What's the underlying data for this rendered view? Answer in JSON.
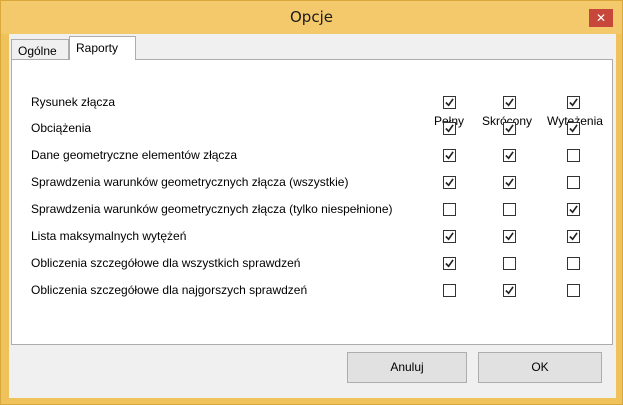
{
  "window": {
    "title": "Opcje",
    "close_glyph": "✕"
  },
  "tabs": [
    {
      "label": "Ogólne",
      "active": false
    },
    {
      "label": "Raporty",
      "active": true
    }
  ],
  "columns": [
    "Pełny",
    "Skrócony",
    "Wytężenia"
  ],
  "rows": [
    {
      "label": "Rysunek złącza",
      "checks": [
        true,
        true,
        true
      ]
    },
    {
      "label": "Obciążenia",
      "checks": [
        true,
        true,
        true
      ]
    },
    {
      "label": "Dane geometryczne elementów złącza",
      "checks": [
        true,
        true,
        false
      ]
    },
    {
      "label": "Sprawdzenia warunków geometrycznych złącza (wszystkie)",
      "checks": [
        true,
        true,
        false
      ]
    },
    {
      "label": "Sprawdzenia warunków geometrycznych złącza (tylko niespełnione)",
      "checks": [
        false,
        false,
        true
      ]
    },
    {
      "label": "Lista maksymalnych wytężeń",
      "checks": [
        true,
        true,
        true
      ]
    },
    {
      "label": "Obliczenia szczegółowe dla wszystkich sprawdzeń",
      "checks": [
        true,
        false,
        false
      ]
    },
    {
      "label": "Obliczenia szczegółowe dla najgorszych sprawdzeń",
      "checks": [
        false,
        true,
        false
      ]
    }
  ],
  "buttons": {
    "cancel": "Anuluj",
    "ok": "OK"
  },
  "colors": {
    "titlebar": "#f4c96b",
    "close": "#c7473a",
    "panel": "#ffffff",
    "button": "#e1e1e1"
  }
}
